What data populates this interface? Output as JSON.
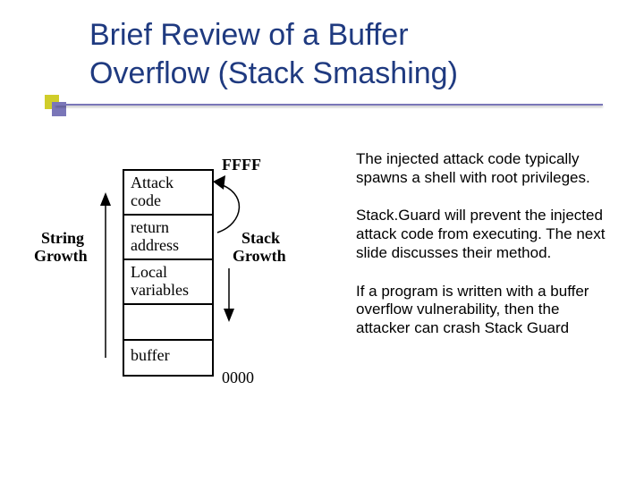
{
  "title": "Brief Review of a Buffer\nOverflow (Stack Smashing)",
  "paragraphs": {
    "p1": "The injected attack code typically spawns a shell with root privileges.",
    "p2": "Stack.Guard will prevent the injected attack code from executing.  The next slide discusses their method.",
    "p3": "If a program is written with a buffer overflow vulnerability, then the attacker can crash Stack Guard"
  },
  "diagram": {
    "top_label": "FFFF",
    "bottom_label": "0000",
    "cells": {
      "attack": "Attack\ncode",
      "return": "return\naddress",
      "local": "Local\nvariables",
      "buffer": "buffer"
    },
    "left_label": "String\nGrowth",
    "right_label": "Stack\nGrowth"
  }
}
